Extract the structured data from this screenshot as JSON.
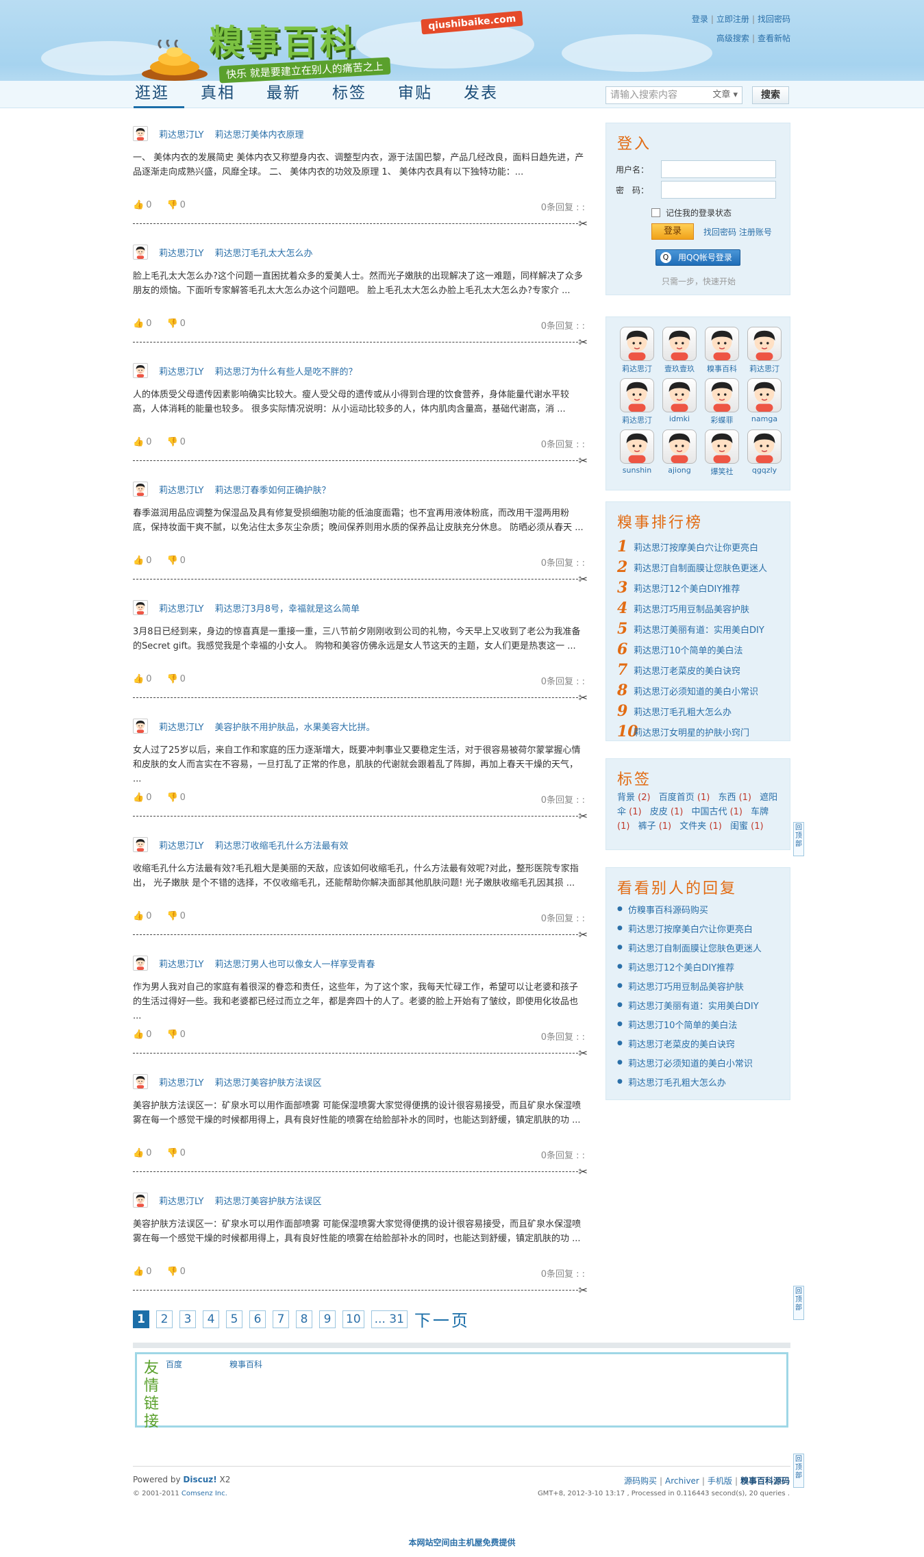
{
  "header": {
    "logo_title": "糗事百科",
    "logo_domain": "qiushibaike.com",
    "logo_slogan": "快乐 就是要建立在别人的痛苦之上",
    "toplinks": {
      "login": "登录",
      "register": "立即注册",
      "find_password": "找回密码",
      "advanced_search": "高级搜索",
      "new_posts": "查看新帖"
    }
  },
  "nav": {
    "items": [
      "逛逛",
      "真相",
      "最新",
      "标签",
      "审贴",
      "发表"
    ],
    "active": 0
  },
  "search": {
    "placeholder": "请输入搜索内容",
    "type": "文章",
    "button": "搜索"
  },
  "posts": [
    {
      "author": "莉达思汀LY",
      "title": "莉达思汀美体内衣原理",
      "body": "一、 美体内衣的发展简史 美体内衣又称塑身内衣、调整型内衣，源于法国巴黎，产品几经改良，面料日趋先进，产品逐渐走向成熟兴盛，风靡全球。 二、 美体内衣的功效及原理 1、 美体内衣具有以下独特功能：...",
      "up": "0",
      "down": "0",
      "comments": "0条回复 : :"
    },
    {
      "author": "莉达思汀LY",
      "title": "莉达思汀毛孔太大怎么办",
      "body": "脸上毛孔太大怎么办?这个问题一直困扰着众多的爱美人士。然而光子嫩肤的出现解决了这一难题，同样解决了众多朋友的烦恼。下面听专家解答毛孔太大怎么办这个问题吧。 脸上毛孔太大怎么办脸上毛孔太大怎么办?专家介 ...",
      "up": "0",
      "down": "0",
      "comments": "0条回复 : :"
    },
    {
      "author": "莉达思汀LY",
      "title": "莉达思汀为什么有些人是吃不胖的？",
      "body": "人的体质受父母遗传因素影响确实比较大。瘦人受父母的遗传或从小得到合理的饮食营养，身体能量代谢水平较高，人体消耗的能量也较多。 很多实际情况说明：从小运动比较多的人，体内肌肉含量高，基础代谢高，消 ...",
      "up": "0",
      "down": "0",
      "comments": "0条回复 : :"
    },
    {
      "author": "莉达思汀LY",
      "title": "莉达思汀春季如何正确护肤？",
      "body": "春季滋润用品应调整为保湿品及具有修复受损细胞功能的低油度面霜；也不宜再用液体粉底，而改用干湿两用粉底，保持妆面干爽不腻，以免沾住太多灰尘杂质；晚间保养则用水质的保养品让皮肤充分休息。 防晒必须从春天 ...",
      "up": "0",
      "down": "0",
      "comments": "0条回复 : :"
    },
    {
      "author": "莉达思汀LY",
      "title": "莉达思汀3月8号，幸福就是这么简单",
      "body": "3月8日已经到来，身边的惊喜真是一重接一重，三八节前夕刚刚收到公司的礼物，今天早上又收到了老公为我准备的Secret gift。我感觉我是个幸福的小女人。 购物和美容仿佛永远是女人节这天的主题，女人们更是热衷这一 ...",
      "up": "0",
      "down": "0",
      "comments": "0条回复 : :"
    },
    {
      "author": "莉达思汀LY",
      "title": "美容护肤不用护肤品，水果美容大比拼。",
      "body": "女人过了25岁以后，来自工作和家庭的压力逐渐增大，既要冲刺事业又要稳定生活，对于很容易被荷尔蒙掌握心情和皮肤的女人而言实在不容易，一旦打乱了正常的作息，肌肤的代谢就会跟着乱了阵脚，再加上春天干燥的天气， ...",
      "up": "0",
      "down": "0",
      "comments": "0条回复 : :"
    },
    {
      "author": "莉达思汀LY",
      "title": "莉达思汀收缩毛孔什么方法最有效",
      "body": "收缩毛孔什么方法最有效?毛孔粗大是美丽的天敌，应该如何收缩毛孔，什么方法最有效呢?对此，整形医院专家指出， 光子嫩肤 是个不错的选择，不仅收缩毛孔，还能帮助你解决面部其他肌肤问题! 光子嫩肤收缩毛孔因其损 ...",
      "up": "0",
      "down": "0",
      "comments": "0条回复 : :"
    },
    {
      "author": "莉达思汀LY",
      "title": "莉达思汀男人也可以像女人一样享受青春",
      "body": "作为男人我对自己的家庭有着很深的眷恋和责任，这些年，为了这个家，我每天忙碌工作，希望可以让老婆和孩子的生活过得好一些。我和老婆都已经过而立之年，都是奔四十的人了。老婆的脸上开始有了皱纹，即使用化妆品也 ...",
      "up": "0",
      "down": "0",
      "comments": "0条回复 : :"
    },
    {
      "author": "莉达思汀LY",
      "title": "莉达思汀美容护肤方法误区",
      "body": "美容护肤方法误区一：矿泉水可以用作面部喷雾 可能保湿喷雾大家觉得便携的设计很容易接受，而且矿泉水保湿喷雾在每一个感觉干燥的时候都用得上，具有良好性能的喷雾在给脸部补水的同时，也能达到舒缓，镇定肌肤的功 ...",
      "up": "0",
      "down": "0",
      "comments": "0条回复 : :"
    },
    {
      "author": "莉达思汀LY",
      "title": "莉达思汀美容护肤方法误区",
      "body": "美容护肤方法误区一：矿泉水可以用作面部喷雾 可能保湿喷雾大家觉得便携的设计很容易接受，而且矿泉水保湿喷雾在每一个感觉干燥的时候都用得上，具有良好性能的喷雾在给脸部补水的同时，也能达到舒缓，镇定肌肤的功 ...",
      "up": "0",
      "down": "0",
      "comments": "0条回复 : :"
    }
  ],
  "pager": {
    "pages": [
      "1",
      "2",
      "3",
      "4",
      "5",
      "6",
      "7",
      "8",
      "9",
      "10",
      "... 31"
    ],
    "next": "下一页"
  },
  "login": {
    "title": "登入",
    "username_label": "用户名：",
    "password_label": "密　码：",
    "remember": "记住我的登录状态",
    "button": "登录",
    "links": "找回密码 注册账号",
    "qq_button": "用QQ帐号登录",
    "qq_icon_text": "Q",
    "quick": "只需一步，快速开始"
  },
  "users": [
    "莉达思汀",
    "壹玖壹玖",
    "糗事百科",
    "莉达思汀",
    "莉达思汀",
    "idmki",
    "彩蝶菲",
    "namga",
    "sunshin",
    "ajiong",
    "爆笑社",
    "qgqzly"
  ],
  "ranking": {
    "title": "糗事排行榜",
    "items": [
      "莉达思汀按摩美白穴让你更亮白",
      "莉达思汀自制面膜让您肤色更迷人",
      "莉达思汀12个美白DIY推荐",
      "莉达思汀巧用豆制品美容护肤",
      "莉达思汀美丽有道：实用美白DIY",
      "莉达思汀10个简单的美白法",
      "莉达思汀老菜皮的美白诀窍",
      "莉达思汀必须知道的美白小常识",
      "莉达思汀毛孔粗大怎么办",
      "莉达思汀女明星的护肤小窍门"
    ]
  },
  "tags": {
    "title": "标签",
    "items": [
      {
        "name": "背景",
        "count": "(2)"
      },
      {
        "name": "百度首页",
        "count": "(1)"
      },
      {
        "name": "东西",
        "count": "(1)"
      },
      {
        "name": "遮阳伞",
        "count": "(1)"
      },
      {
        "name": "皮皮",
        "count": "(1)"
      },
      {
        "name": "中国古代",
        "count": "(1)"
      },
      {
        "name": "车牌",
        "count": "(1)"
      },
      {
        "name": "裤子",
        "count": "(1)"
      },
      {
        "name": "文件夹",
        "count": "(1)"
      },
      {
        "name": "闺蜜",
        "count": "(1)"
      }
    ]
  },
  "replies": {
    "title": "看看别人的回复",
    "items": [
      "仿糗事百科源码购买",
      "莉达思汀按摩美白穴让你更亮白",
      "莉达思汀自制面膜让您肤色更迷人",
      "莉达思汀12个美白DIY推荐",
      "莉达思汀巧用豆制品美容护肤",
      "莉达思汀美丽有道：实用美白DIY",
      "莉达思汀10个简单的美白法",
      "莉达思汀老菜皮的美白诀窍",
      "莉达思汀必须知道的美白小常识",
      "莉达思汀毛孔粗大怎么办"
    ]
  },
  "links": {
    "title": "友情链接",
    "items": [
      "百度",
      "糗事百科"
    ]
  },
  "footer": {
    "powered_prefix": "Powered by ",
    "powered_name": "Discuz!",
    "powered_version": " X2",
    "copyright_prefix": "© 2001-2011 ",
    "copyright_company": "Comsenz Inc.",
    "links": [
      "源码购买",
      "Archiver",
      "手机版",
      "糗事百科源码"
    ],
    "info": "GMT+8, 2012-3-10 13:17 , Processed in 0.116443 second(s), 20 queries .",
    "host": "本网站空间由主机屋免费提供"
  },
  "backtop": "回顶部",
  "colors": {
    "accent": "#1b6ea8",
    "orange": "#e26b12",
    "link": "#2a6fa8",
    "sidebar_bg": "#e6f1f8"
  }
}
